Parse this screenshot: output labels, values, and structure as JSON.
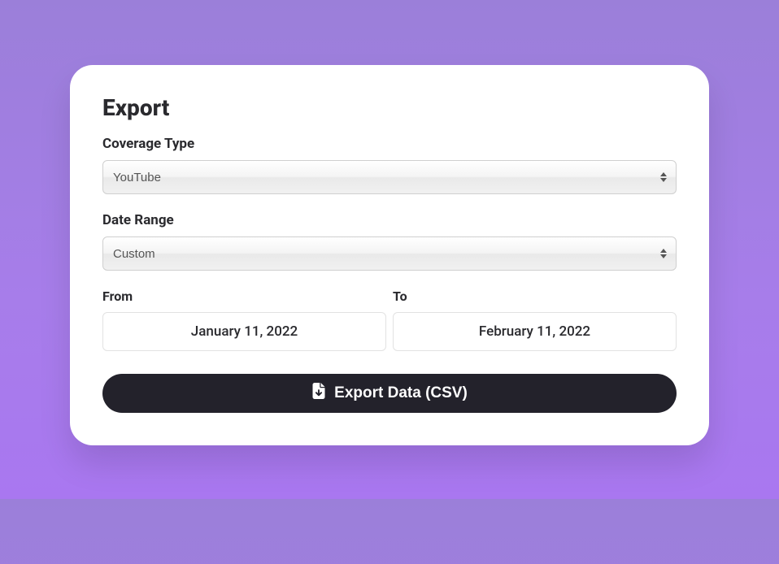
{
  "title": "Export",
  "coverage": {
    "label": "Coverage Type",
    "value": "YouTube"
  },
  "daterange": {
    "label": "Date Range",
    "value": "Custom",
    "from_label": "From",
    "to_label": "To",
    "from_value": "January 11, 2022",
    "to_value": "February 11, 2022"
  },
  "button": {
    "label": "Export Data (CSV)"
  }
}
